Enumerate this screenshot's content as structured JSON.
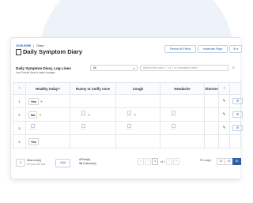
{
  "breadcrumb": {
    "id": "1049-8095",
    "separator": "|",
    "diary_label": "Diary"
  },
  "page_title": "Daily Symptom Diary",
  "top_buttons": {
    "freeze": "Freeze All Fields",
    "inactivate": "Inactivate Page",
    "gear": "⚙ ▾"
  },
  "log": {
    "title": "Daily Symptom Diary, Log Lines",
    "note": "Use Portrait View to make changes"
  },
  "filter": {
    "value": "All"
  },
  "search": {
    "placeholder": "Search field value, '!' or '|' for mandatory fields"
  },
  "table": {
    "columns": [
      "",
      "Healthy today?",
      "Runny or stuffy nose",
      "Cough",
      "Headache",
      "Shortne"
    ],
    "rows": [
      {
        "num": "1",
        "healthy": "Yes"
      },
      {
        "num": "2",
        "healthy": "No"
      },
      {
        "num": "3",
        "healthy": ""
      },
      {
        "num": "4",
        "healthy": "Yes"
      }
    ]
  },
  "footer": {
    "rows_input": "1",
    "new_rows": "New row(s)",
    "position": "On pos next row",
    "add": "Add",
    "rows_count": "4",
    "rows_label": "Row(s)",
    "cols_count": "10",
    "cols_label": "Column(s)",
    "page": "1",
    "page_of": "of 1",
    "per_page_label": "Per page:",
    "per_page_options": [
      "10",
      "25",
      "50"
    ]
  },
  "accent": "#2f5ea8"
}
